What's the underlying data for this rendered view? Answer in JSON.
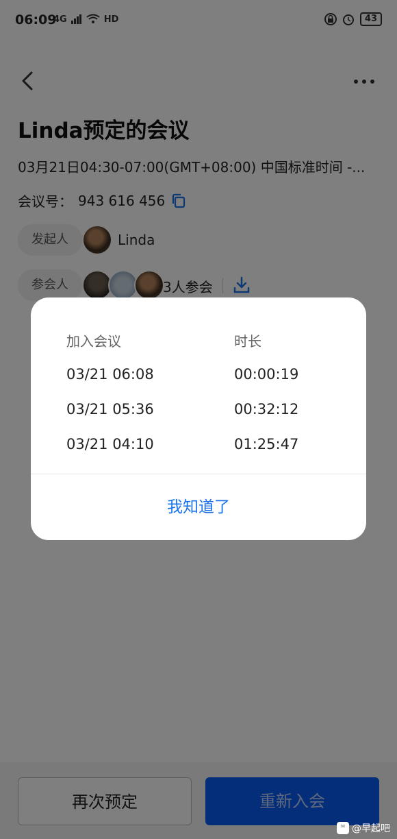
{
  "status": {
    "time": "06:09",
    "left_icons": [
      "4G",
      "HD"
    ],
    "battery": "43"
  },
  "header": {
    "title": "Linda预定的会议",
    "time_range": "03月21日04:30-07:00(GMT+08:00) 中国标准时间 -...",
    "meeting_no_label": "会议号：",
    "meeting_no": "943 616 456"
  },
  "host": {
    "label": "发起人",
    "name": "Linda"
  },
  "attendees": {
    "label": "参会人",
    "count_text": "3人参会"
  },
  "dialog": {
    "col_join": "加入会议",
    "col_duration": "时长",
    "rows": [
      {
        "join": "03/21 06:08",
        "duration": "00:00:19"
      },
      {
        "join": "03/21 05:36",
        "duration": "00:32:12"
      },
      {
        "join": "03/21 04:10",
        "duration": "01:25:47"
      }
    ],
    "confirm": "我知道了"
  },
  "actions": {
    "rebook": "再次预定",
    "rejoin": "重新入会"
  },
  "watermark": {
    "logo": "ᴹ",
    "text": "@早起吧"
  },
  "colors": {
    "accent": "#1a73e8",
    "primary_button": "#0a5cf5"
  }
}
